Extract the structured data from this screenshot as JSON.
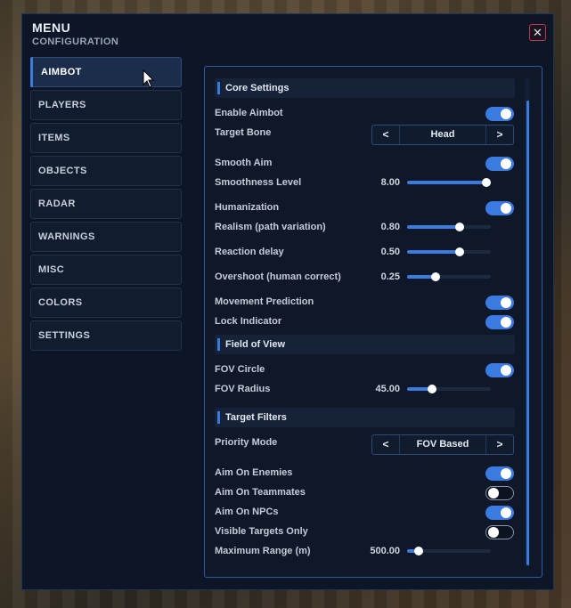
{
  "window": {
    "title": "MENU",
    "subtitle": "CONFIGURATION",
    "close_label": "✕"
  },
  "sidebar": {
    "items": [
      {
        "label": "AIMBOT",
        "active": true
      },
      {
        "label": "PLAYERS"
      },
      {
        "label": "ITEMS"
      },
      {
        "label": "OBJECTS"
      },
      {
        "label": "RADAR"
      },
      {
        "label": "WARNINGS"
      },
      {
        "label": "MISC"
      },
      {
        "label": "COLORS"
      },
      {
        "label": "SETTINGS"
      }
    ]
  },
  "panel": {
    "sections": {
      "core": "Core Settings",
      "fov": "Field of View",
      "filters": "Target Filters"
    },
    "enable_aimbot": {
      "label": "Enable Aimbot",
      "on": true
    },
    "target_bone": {
      "label": "Target Bone",
      "value": "Head",
      "prev": "<",
      "next": ">"
    },
    "smooth_aim": {
      "label": "Smooth Aim",
      "on": true
    },
    "smoothness": {
      "label": "Smoothness Level",
      "value": "8.00",
      "fraction": 1.0
    },
    "humanization": {
      "label": "Humanization",
      "on": true
    },
    "realism": {
      "label": "Realism (path variation)",
      "value": "0.80",
      "fraction": 0.64
    },
    "reaction_delay": {
      "label": "Reaction delay",
      "value": "0.50",
      "fraction": 0.64
    },
    "overshoot": {
      "label": "Overshoot (human correct)",
      "value": "0.25",
      "fraction": 0.32
    },
    "movement_prediction": {
      "label": "Movement Prediction",
      "on": true
    },
    "lock_indicator": {
      "label": "Lock Indicator",
      "on": true
    },
    "fov_circle": {
      "label": "FOV Circle",
      "on": true
    },
    "fov_radius": {
      "label": "FOV Radius",
      "value": "45.00",
      "fraction": 0.27
    },
    "priority_mode": {
      "label": "Priority Mode",
      "value": "FOV Based",
      "prev": "<",
      "next": ">"
    },
    "aim_enemies": {
      "label": "Aim On Enemies",
      "on": true
    },
    "aim_teammates": {
      "label": "Aim On Teammates",
      "on": false
    },
    "aim_npcs": {
      "label": "Aim On NPCs",
      "on": true
    },
    "visible_only": {
      "label": "Visible Targets Only",
      "on": false
    },
    "max_range": {
      "label": "Maximum Range (m)",
      "value": "500.00",
      "fraction": 0.1
    }
  },
  "colors": {
    "accent": "#3b7be0",
    "close_border": "#c1384e",
    "window_bg": "#0d1626"
  }
}
